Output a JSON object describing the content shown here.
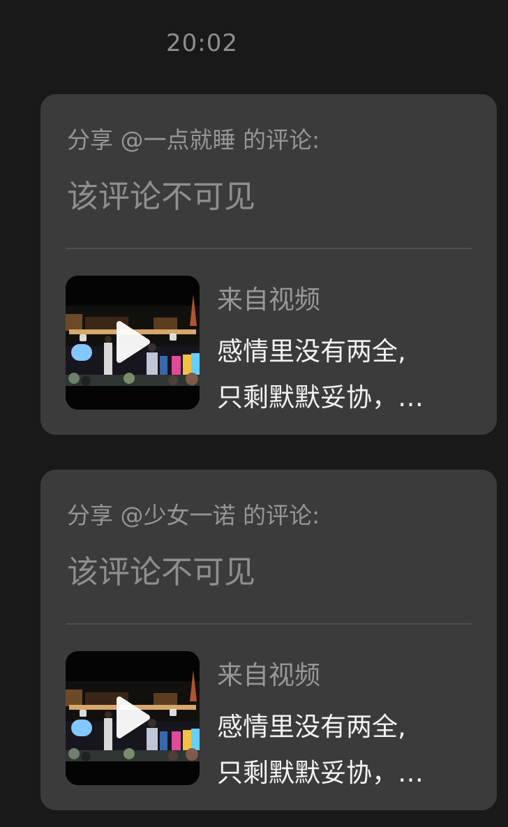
{
  "chat": {
    "time": "20:02",
    "messages": [
      {
        "share_title": "分享 @一点就睡 的评论:",
        "comment_status": "该评论不可见",
        "source_label": "来自视频",
        "video_desc_line1": "感情里没有两全,",
        "video_desc_line2": "只剩默默妥协，…"
      },
      {
        "share_title": "分享 @少女一诺 的评论:",
        "comment_status": "该评论不可见",
        "source_label": "来自视频",
        "video_desc_line1": "感情里没有两全,",
        "video_desc_line2": "只剩默默妥协，…"
      }
    ]
  },
  "theme": {
    "background": "#191919",
    "card": "#3b3b3b",
    "muted_text": "#969696",
    "primary_text": "#f2f2f2"
  },
  "icons": {
    "play": "play-icon"
  }
}
